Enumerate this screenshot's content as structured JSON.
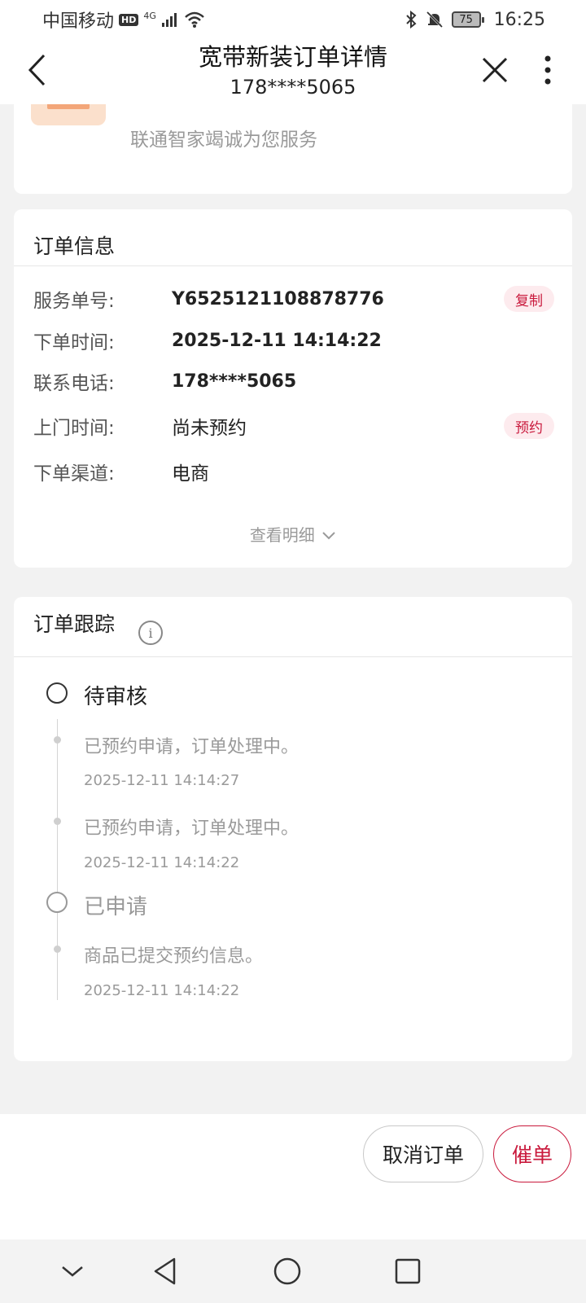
{
  "status_bar": {
    "carrier": "中国移动",
    "hd": "HD",
    "network": "4G",
    "battery": "75",
    "time": "16:25"
  },
  "title_bar": {
    "title": "宽带新装订单详情",
    "subtitle": "178****5065"
  },
  "top_card": {
    "service_text": "联通智家竭诚为您服务"
  },
  "order_info": {
    "title": "订单信息",
    "rows": [
      {
        "label": "服务单号:",
        "value": "Y6525121108878776",
        "action": "复制"
      },
      {
        "label": "下单时间:",
        "value": "2025-12-11 14:14:22"
      },
      {
        "label": "联系电话:",
        "value": "178****5065"
      },
      {
        "label": "上门时间:",
        "value": "尚未预约",
        "action": "预约"
      },
      {
        "label": "下单渠道:",
        "value": "电商"
      }
    ],
    "detail_toggle": "查看明细"
  },
  "order_tracking": {
    "title": "订单跟踪",
    "info_icon": "info-icon",
    "groups": [
      {
        "status": "待审核",
        "entries": [
          {
            "message": "已预约申请，订单处理中。",
            "time": "2025-12-11 14:14:27"
          },
          {
            "message": "已预约申请，订单处理中。",
            "time": "2025-12-11 14:14:22"
          }
        ]
      },
      {
        "status": "已申请",
        "entries": [
          {
            "message": "商品已提交预约信息。",
            "time": "2025-12-11 14:14:22"
          }
        ]
      }
    ]
  },
  "actions": {
    "cancel": "取消订单",
    "urge": "催单"
  },
  "colors": {
    "accent": "#c9193c",
    "tag_bg": "#fdebee",
    "page_bg": "#f2f2f2"
  }
}
